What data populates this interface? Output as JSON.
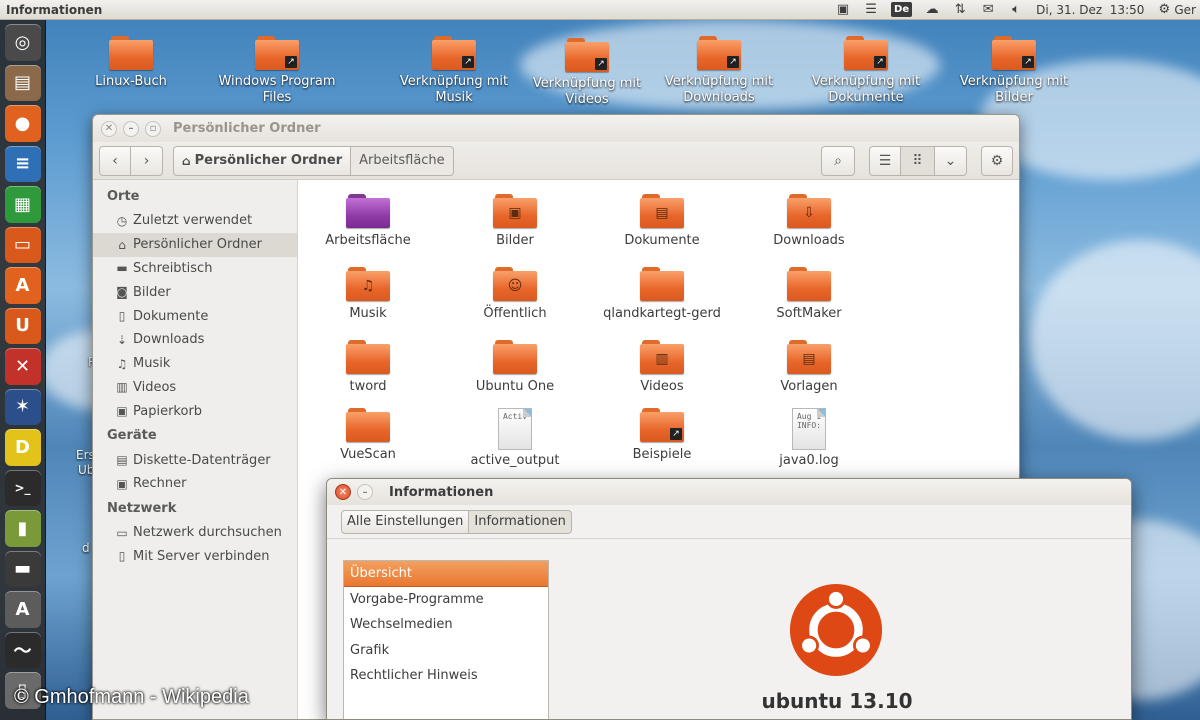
{
  "top_panel": {
    "app_title": "Informationen",
    "keyboard_layout": "De",
    "datetime": "Di, 31. Dez  13:50",
    "gear_label": "Ger"
  },
  "launcher": {
    "items": [
      {
        "icon": "dash-home-icon",
        "color": "#4a4a4a",
        "glyph": "◎"
      },
      {
        "icon": "file-manager-icon",
        "color": "#8a6a4a",
        "glyph": "▤"
      },
      {
        "icon": "firefox-icon",
        "color": "#e0621e",
        "glyph": "●"
      },
      {
        "icon": "libreoffice-writer-icon",
        "color": "#2f6fb6",
        "glyph": "≡"
      },
      {
        "icon": "libreoffice-calc-icon",
        "color": "#2f9a3c",
        "glyph": "▦"
      },
      {
        "icon": "libreoffice-impress-icon",
        "color": "#d9581c",
        "glyph": "▭"
      },
      {
        "icon": "software-center-icon",
        "color": "#e0621e",
        "glyph": "A"
      },
      {
        "icon": "ubuntu-one-icon",
        "color": "#d9581c",
        "glyph": "U"
      },
      {
        "icon": "system-settings-icon",
        "color": "#c2322b",
        "glyph": "✕"
      },
      {
        "icon": "network-tool-icon",
        "color": "#2a4f8a",
        "glyph": "✶"
      },
      {
        "icon": "softmaker-icon",
        "color": "#e3c21a",
        "glyph": "D"
      },
      {
        "icon": "terminal-icon",
        "color": "#2b2b2b",
        "glyph": ">_"
      },
      {
        "icon": "archive-icon",
        "color": "#7a9a3a",
        "glyph": "▮"
      },
      {
        "icon": "floppy-icon",
        "color": "#3a3a3a",
        "glyph": "▬"
      },
      {
        "icon": "update-manager-icon",
        "color": "#5c5c5c",
        "glyph": "A"
      },
      {
        "icon": "system-monitor-icon",
        "color": "#2b2b2b",
        "glyph": "〜"
      },
      {
        "icon": "trash-icon",
        "color": "#6a6a6a",
        "glyph": "▯"
      }
    ]
  },
  "desktop": {
    "icons": [
      {
        "label": "Linux-Buch",
        "link": false
      },
      {
        "label": "Windows Program Files",
        "link": true
      },
      {
        "label": "Verknüpfung mit Musik",
        "link": true
      },
      {
        "label": "Verknüpfung mit Videos",
        "link": true
      },
      {
        "label": "Verknüpfung mit Downloads",
        "link": true
      },
      {
        "label": "Verknüpfung mit Dokumente",
        "link": true
      },
      {
        "label": "Verknüpfung mit Bilder",
        "link": true
      }
    ],
    "edge_texts": [
      "Ers",
      "Ub",
      "d",
      "R"
    ]
  },
  "nautilus": {
    "title": "Persönlicher Ordner",
    "breadcrumb": [
      "Persönlicher Ordner",
      "Arbeitsfläche"
    ],
    "sidebar": {
      "sections": [
        {
          "heading": "Orte",
          "items": [
            {
              "label": "Zuletzt verwendet",
              "icon": "clock-icon",
              "glyph": "◷"
            },
            {
              "label": "Persönlicher Ordner",
              "icon": "home-icon",
              "glyph": "⌂",
              "selected": true
            },
            {
              "label": "Schreibtisch",
              "icon": "desktop-icon",
              "glyph": "▬"
            },
            {
              "label": "Bilder",
              "icon": "camera-icon",
              "glyph": "◙"
            },
            {
              "label": "Dokumente",
              "icon": "document-icon",
              "glyph": "▯"
            },
            {
              "label": "Downloads",
              "icon": "download-icon",
              "glyph": "⇣"
            },
            {
              "label": "Musik",
              "icon": "music-icon",
              "glyph": "♫"
            },
            {
              "label": "Videos",
              "icon": "film-icon",
              "glyph": "▥"
            },
            {
              "label": "Papierkorb",
              "icon": "trash-icon",
              "glyph": "▣"
            }
          ]
        },
        {
          "heading": "Geräte",
          "items": [
            {
              "label": "Diskette-Datenträger",
              "icon": "floppy-icon",
              "glyph": "▤"
            },
            {
              "label": "Rechner",
              "icon": "computer-icon",
              "glyph": "▣"
            }
          ]
        },
        {
          "heading": "Netzwerk",
          "items": [
            {
              "label": "Netzwerk durchsuchen",
              "icon": "network-icon",
              "glyph": "▭"
            },
            {
              "label": "Mit Server verbinden",
              "icon": "server-icon",
              "glyph": "▯"
            }
          ]
        }
      ]
    },
    "files": [
      {
        "label": "Arbeitsfläche",
        "kind": "folder-purple",
        "emblem": ""
      },
      {
        "label": "Bilder",
        "kind": "folder",
        "emblem": "▣"
      },
      {
        "label": "Dokumente",
        "kind": "folder",
        "emblem": "▤"
      },
      {
        "label": "Downloads",
        "kind": "folder",
        "emblem": "⇩"
      },
      {
        "label": "Musik",
        "kind": "folder",
        "emblem": "♫"
      },
      {
        "label": "Öffentlich",
        "kind": "folder",
        "emblem": "☺"
      },
      {
        "label": "qlandkartegt-gerd",
        "kind": "folder",
        "emblem": ""
      },
      {
        "label": "SoftMaker",
        "kind": "folder",
        "emblem": ""
      },
      {
        "label": "tword",
        "kind": "folder",
        "emblem": ""
      },
      {
        "label": "Ubuntu One",
        "kind": "folder",
        "emblem": ""
      },
      {
        "label": "Videos",
        "kind": "folder",
        "emblem": "▥"
      },
      {
        "label": "Vorlagen",
        "kind": "folder",
        "emblem": "▤"
      },
      {
        "label": "VueScan",
        "kind": "folder",
        "emblem": ""
      },
      {
        "label": "active_output",
        "kind": "file",
        "preview": "Activ"
      },
      {
        "label": "Beispiele",
        "kind": "folder-link",
        "emblem": ""
      },
      {
        "label": "java0.log",
        "kind": "file",
        "preview": "Aug 1\nINFO:"
      }
    ]
  },
  "info_dialog": {
    "title": "Informationen",
    "nav": [
      "Alle Einstellungen",
      "Informationen"
    ],
    "list": [
      "Übersicht",
      "Vorgabe-Programme",
      "Wechselmedien",
      "Grafik",
      "Rechtlicher Hinweis"
    ],
    "selected_index": 0,
    "os_name": "ubuntu 13.10",
    "accent": "#dd4814"
  },
  "watermark": "© Gmhofmann - Wikipedia"
}
